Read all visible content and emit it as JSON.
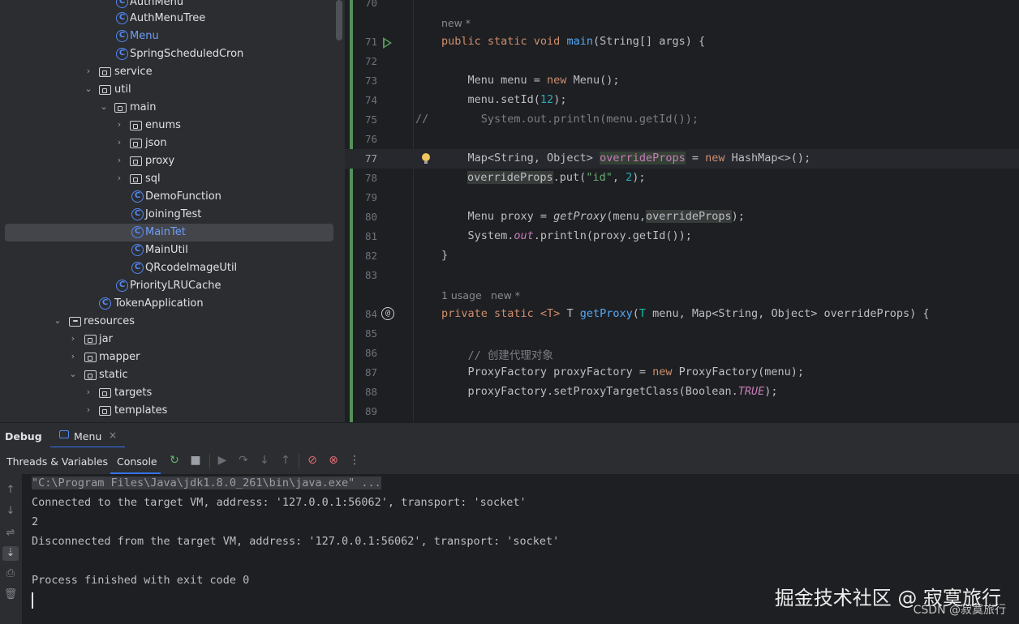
{
  "tree": {
    "items": [
      {
        "label": "AuthMenu",
        "type": "class"
      },
      {
        "label": "AuthMenuTree",
        "type": "class"
      },
      {
        "label": "Menu",
        "type": "class"
      },
      {
        "label": "SpringScheduledCron",
        "type": "class"
      },
      {
        "label": "service",
        "type": "folder"
      },
      {
        "label": "util",
        "type": "folder"
      },
      {
        "label": "main",
        "type": "folder"
      },
      {
        "label": "enums",
        "type": "folder"
      },
      {
        "label": "json",
        "type": "folder"
      },
      {
        "label": "proxy",
        "type": "folder"
      },
      {
        "label": "sql",
        "type": "folder"
      },
      {
        "label": "DemoFunction",
        "type": "class"
      },
      {
        "label": "JoiningTest",
        "type": "class"
      },
      {
        "label": "MainTet",
        "type": "class",
        "selected": true
      },
      {
        "label": "MainUtil",
        "type": "class"
      },
      {
        "label": "QRcodeImageUtil",
        "type": "class"
      },
      {
        "label": "PriorityLRUCache",
        "type": "class"
      },
      {
        "label": "TokenApplication",
        "type": "class"
      },
      {
        "label": "resources",
        "type": "folder"
      },
      {
        "label": "jar",
        "type": "folder"
      },
      {
        "label": "mapper",
        "type": "folder"
      },
      {
        "label": "static",
        "type": "folder"
      },
      {
        "label": "targets",
        "type": "folder"
      },
      {
        "label": "templates",
        "type": "folder"
      }
    ]
  },
  "editor": {
    "line_numbers": [
      "70",
      "71",
      "72",
      "73",
      "74",
      "75",
      "76",
      "77",
      "78",
      "79",
      "80",
      "81",
      "82",
      "83",
      "84",
      "85",
      "86",
      "87",
      "88",
      "89"
    ],
    "hint_new": "new *",
    "hint_usage": "1 usage",
    "hint_new2": "new *",
    "line_comment_marker": "//",
    "code": {
      "l71a": "public static void ",
      "l71b": "main",
      "l71c": "(String[] args) {",
      "l73a": "    Menu menu = ",
      "l73b": "new",
      "l73c": " Menu();",
      "l74a": "    menu.setId(",
      "l74b": "12",
      "l74c": ");",
      "l75": "      System.out.println(menu.getId());",
      "l77a": "    Map<String, Object> ",
      "l77b": "overrideProps",
      "l77c": " = ",
      "l77d": "new",
      "l77e": " HashMap<>();",
      "l78a": "overrideProps",
      "l78b": ".put(",
      "l78c": "\"id\"",
      "l78d": ", ",
      "l78e": "2",
      "l78f": ");",
      "l80a": "    Menu proxy = ",
      "l80b": "getProxy",
      "l80c": "(menu,",
      "l80d": "overrideProps",
      "l80e": ");",
      "l81a": "    System.",
      "l81b": "out",
      "l81c": ".println(proxy.getId());",
      "l82": "}",
      "l84a": "private static ",
      "l84b": "<T>",
      "l84c": " T ",
      "l84d": "getProxy",
      "l84e": "(",
      "l84f": "T",
      "l84g": " menu, Map<String, Object> overrideProps) {",
      "l86": "    // 创建代理对象",
      "l87a": "    ProxyFactory proxyFactory = ",
      "l87b": "new",
      "l87c": " ProxyFactory(menu);",
      "l88a": "    proxyFactory.setProxyTargetClass(Boolean.",
      "l88b": "TRUE",
      "l88c": ");"
    }
  },
  "debug": {
    "title": "Debug",
    "tab_label": "Menu",
    "tab_close": "×"
  },
  "toolbar": {
    "threads_tab": "Threads & Variables",
    "console_tab": "Console"
  },
  "console": {
    "lines": [
      "\"C:\\Program Files\\Java\\jdk1.8.0_261\\bin\\java.exe\" ...",
      "Connected to the target VM, address: '127.0.0.1:56062', transport: 'socket'",
      "2",
      "Disconnected from the target VM, address: '127.0.0.1:56062', transport: 'socket'",
      "",
      "Process finished with exit code 0"
    ]
  },
  "watermark": {
    "main": "掘金技术社区 @ 寂寞旅行",
    "sub": "CSDN @寂寞旅行"
  }
}
